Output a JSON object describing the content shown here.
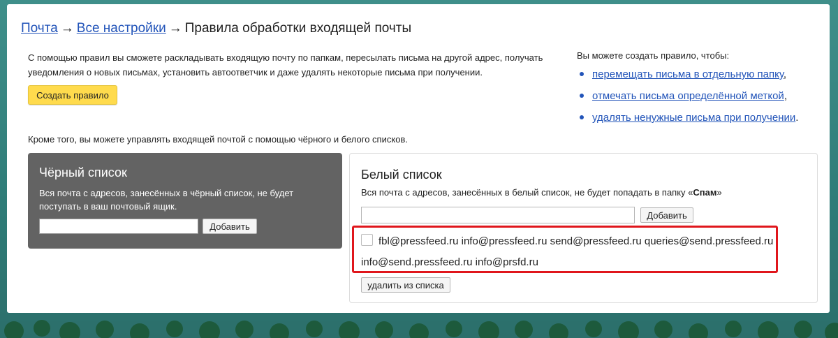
{
  "breadcrumb": {
    "mail": "Почта",
    "arrow1": "→",
    "all_settings": "Все настройки",
    "arrow2": "→",
    "current": "Правила обработки входящей почты"
  },
  "intro": {
    "text": "С помощью правил вы сможете раскладывать входящую почту по папкам, пересылать письма на другой адрес, получать уведомления о новых письмах, установить автоответчик и даже удалять некоторые письма при получении."
  },
  "create_rule_button": "Создать правило",
  "rules_info": {
    "title": "Вы можете создать правило, чтобы:",
    "items": [
      {
        "label": "перемещать письма в отдельную папку",
        "suffix": ","
      },
      {
        "label": "отмечать письма определённой меткой",
        "suffix": ","
      },
      {
        "label": "удалять ненужные письма при получении",
        "suffix": "."
      }
    ]
  },
  "lists_intro": "Кроме того, вы можете управлять входящей почтой с помощью чёрного и белого списков.",
  "blacklist": {
    "title": "Чёрный список",
    "description": "Вся почта с адресов, занесённых в чёрный список, не будет поступать в ваш почтовый ящик.",
    "input_value": "",
    "add_label": "Добавить"
  },
  "whitelist": {
    "title": "Белый список",
    "description_prefix": "Вся почта с адресов, занесённых в белый список, не будет попадать в папку «",
    "description_bold": "Спам",
    "description_suffix": "»",
    "input_value": "",
    "add_label": "Добавить",
    "entries_line1": "fbl@pressfeed.ru info@pressfeed.ru send@pressfeed.ru queries@send.pressfeed.ru",
    "entries_line2": "info@send.pressfeed.ru info@prsfd.ru",
    "remove_label": "удалить из списка"
  },
  "colors": {
    "link": "#2254b9",
    "accent_button": "#ffdb4d",
    "blacklist_bg": "#636363",
    "highlight": "#e0161c"
  }
}
